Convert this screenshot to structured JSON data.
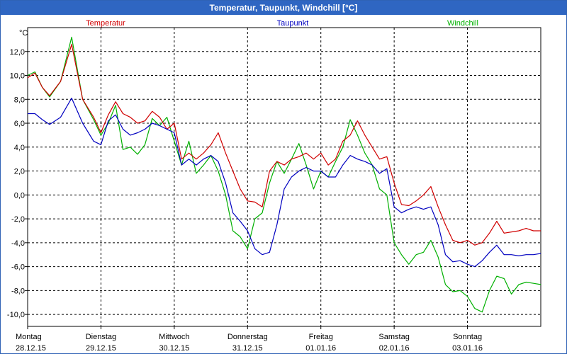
{
  "window": {
    "title": "Temperatur, Taupunkt, Windchill [°C]"
  },
  "chart_data": {
    "type": "line",
    "title": "Temperatur, Taupunkt, Windchill [°C]",
    "ylabel": "°C",
    "xlabel": "",
    "ylim": [
      -11,
      14
    ],
    "xlim": [
      0,
      7
    ],
    "yticks": [
      12,
      10,
      8,
      6,
      4,
      2,
      0,
      -2,
      -4,
      -6,
      -8,
      -10
    ],
    "ytick_labels": [
      "12,0",
      "10,0",
      "8,0",
      "6,0",
      "4,0",
      "2,0",
      "0,0",
      "-2,0",
      "-4,0",
      "-6,0",
      "-8,0",
      "-10,0"
    ],
    "x_tick_days": [
      {
        "day": "Montag",
        "date": "28.12.15"
      },
      {
        "day": "Dienstag",
        "date": "29.12.15"
      },
      {
        "day": "Mittwoch",
        "date": "30.12.15"
      },
      {
        "day": "Donnerstag",
        "date": "31.12.15"
      },
      {
        "day": "Freitag",
        "date": "01.01.16"
      },
      {
        "day": "Samstag",
        "date": "02.01.16"
      },
      {
        "day": "Sonntag",
        "date": "03.01.16"
      }
    ],
    "grid": true,
    "legend_placement": "top",
    "series": [
      {
        "name": "Temperatur",
        "color": "#d00000",
        "x": [
          0,
          0.1,
          0.2,
          0.3,
          0.45,
          0.6,
          0.75,
          0.9,
          1.0,
          1.1,
          1.2,
          1.3,
          1.4,
          1.5,
          1.6,
          1.7,
          1.8,
          1.9,
          2.0,
          2.1,
          2.2,
          2.3,
          2.4,
          2.5,
          2.6,
          2.7,
          2.8,
          2.9,
          3.0,
          3.1,
          3.2,
          3.3,
          3.4,
          3.5,
          3.6,
          3.7,
          3.8,
          3.9,
          4.0,
          4.1,
          4.2,
          4.3,
          4.4,
          4.5,
          4.6,
          4.7,
          4.8,
          4.9,
          5.0,
          5.1,
          5.2,
          5.3,
          5.4,
          5.5,
          5.6,
          5.7,
          5.8,
          5.9,
          6.0,
          6.1,
          6.2,
          6.3,
          6.4,
          6.5,
          6.6,
          6.7,
          6.8,
          6.9,
          7.0
        ],
        "values": [
          9.8,
          10.2,
          9.0,
          8.3,
          9.5,
          12.6,
          8.0,
          6.5,
          5.2,
          6.7,
          7.8,
          6.8,
          6.5,
          6.0,
          6.2,
          7.0,
          6.5,
          5.5,
          6.0,
          3.0,
          3.5,
          3.0,
          3.5,
          4.2,
          5.2,
          3.5,
          2.0,
          0.5,
          -0.5,
          -0.6,
          -1.0,
          2.0,
          2.8,
          2.5,
          3.0,
          3.2,
          3.5,
          3.0,
          3.5,
          2.5,
          3.0,
          4.5,
          5.0,
          6.2,
          5.0,
          4.0,
          3.0,
          3.2,
          1.0,
          -0.8,
          -0.9,
          -0.5,
          0.0,
          0.7,
          -1.0,
          -2.5,
          -3.8,
          -4.0,
          -3.8,
          -4.2,
          -4.0,
          -3.2,
          -2.2,
          -3.2,
          -3.1,
          -3.0,
          -2.8,
          -3.0,
          -3.0
        ]
      },
      {
        "name": "Taupunkt",
        "color": "#0000c0",
        "x": [
          0,
          0.1,
          0.2,
          0.3,
          0.45,
          0.6,
          0.75,
          0.9,
          1.0,
          1.1,
          1.2,
          1.3,
          1.4,
          1.5,
          1.6,
          1.7,
          1.8,
          1.9,
          2.0,
          2.1,
          2.2,
          2.3,
          2.4,
          2.5,
          2.6,
          2.7,
          2.8,
          2.9,
          3.0,
          3.1,
          3.2,
          3.3,
          3.4,
          3.5,
          3.6,
          3.7,
          3.8,
          3.9,
          4.0,
          4.1,
          4.2,
          4.3,
          4.4,
          4.5,
          4.6,
          4.7,
          4.8,
          4.9,
          5.0,
          5.1,
          5.2,
          5.3,
          5.4,
          5.5,
          5.6,
          5.7,
          5.8,
          5.9,
          6.0,
          6.1,
          6.2,
          6.3,
          6.4,
          6.5,
          6.6,
          6.7,
          6.8,
          6.9,
          7.0
        ],
        "values": [
          6.8,
          6.8,
          6.3,
          5.9,
          6.5,
          8.1,
          6.0,
          4.5,
          4.2,
          6.2,
          6.7,
          5.5,
          5.0,
          5.2,
          5.5,
          6.0,
          5.8,
          5.5,
          5.2,
          2.5,
          3.0,
          2.5,
          3.0,
          3.3,
          2.8,
          1.0,
          -1.5,
          -2.2,
          -3.0,
          -4.5,
          -5.0,
          -4.8,
          -2.5,
          0.5,
          1.5,
          2.0,
          2.3,
          2.0,
          2.0,
          1.5,
          1.5,
          2.5,
          3.3,
          3.0,
          2.8,
          2.5,
          1.8,
          2.2,
          -1.0,
          -1.5,
          -1.2,
          -1.0,
          -1.2,
          -1.0,
          -2.5,
          -5.0,
          -5.6,
          -5.5,
          -5.8,
          -6.0,
          -5.5,
          -4.8,
          -4.2,
          -5.0,
          -5.0,
          -5.1,
          -5.0,
          -5.0,
          -4.9
        ]
      },
      {
        "name": "Windchill",
        "color": "#00b000",
        "x": [
          0,
          0.1,
          0.2,
          0.3,
          0.45,
          0.6,
          0.75,
          0.9,
          1.0,
          1.1,
          1.2,
          1.3,
          1.4,
          1.5,
          1.6,
          1.7,
          1.8,
          1.9,
          2.0,
          2.1,
          2.2,
          2.3,
          2.4,
          2.5,
          2.6,
          2.7,
          2.8,
          2.9,
          3.0,
          3.1,
          3.2,
          3.3,
          3.4,
          3.5,
          3.6,
          3.7,
          3.8,
          3.9,
          4.0,
          4.1,
          4.2,
          4.3,
          4.4,
          4.5,
          4.6,
          4.7,
          4.8,
          4.9,
          5.0,
          5.1,
          5.2,
          5.3,
          5.4,
          5.5,
          5.6,
          5.7,
          5.8,
          5.9,
          6.0,
          6.1,
          6.2,
          6.3,
          6.4,
          6.5,
          6.6,
          6.7,
          6.8,
          6.9,
          7.0
        ],
        "values": [
          10.0,
          10.3,
          9.0,
          8.2,
          9.5,
          13.2,
          8.0,
          6.3,
          5.0,
          6.0,
          7.5,
          3.8,
          4.0,
          3.4,
          4.2,
          6.4,
          5.8,
          6.5,
          4.5,
          2.5,
          4.5,
          1.8,
          2.5,
          3.3,
          2.0,
          0.0,
          -3.0,
          -3.5,
          -4.5,
          -2.0,
          -1.5,
          1.0,
          2.8,
          1.8,
          3.0,
          4.3,
          2.5,
          0.5,
          2.0,
          1.5,
          2.8,
          4.0,
          6.3,
          5.0,
          3.5,
          2.5,
          0.5,
          0.0,
          -4.0,
          -5.0,
          -5.8,
          -5.0,
          -4.8,
          -3.8,
          -5.2,
          -7.5,
          -8.1,
          -8.0,
          -8.5,
          -9.5,
          -9.8,
          -8.0,
          -6.8,
          -7.0,
          -8.3,
          -7.5,
          -7.3,
          -7.4,
          -7.5
        ]
      }
    ]
  }
}
